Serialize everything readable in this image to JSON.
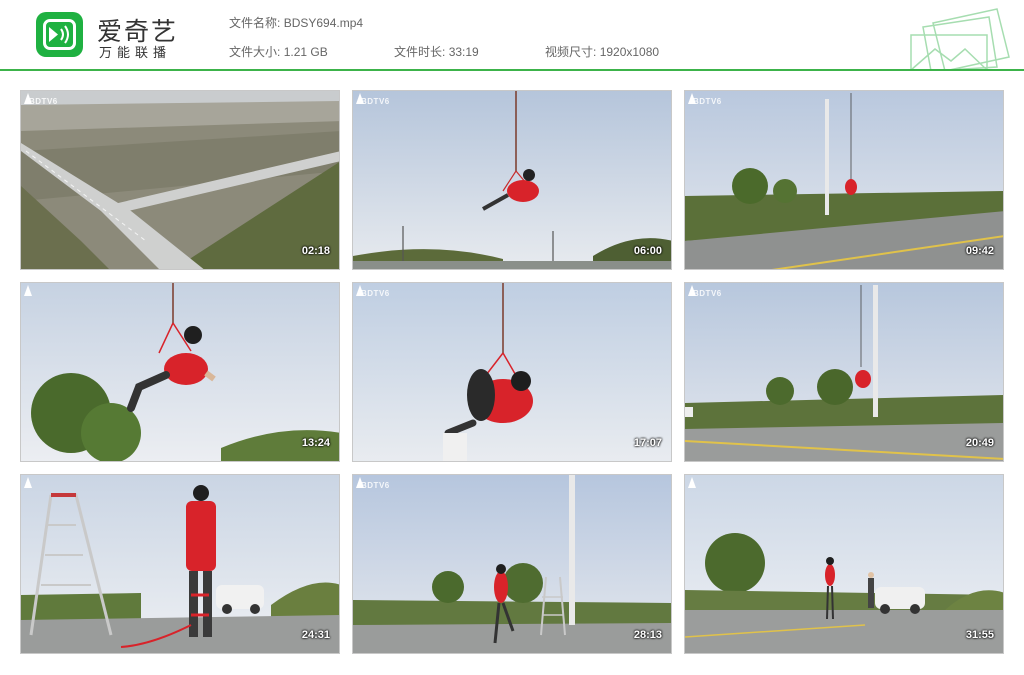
{
  "app": {
    "brand_name": "爱奇艺",
    "brand_sub": "万能联播",
    "brand_color": "#1fb141"
  },
  "file_info": {
    "name_label": "文件名称:",
    "name_value": "BDSY694.mp4",
    "size_label": "文件大小:",
    "size_value": "1.21 GB",
    "duration_label": "文件时长:",
    "duration_value": "33:19",
    "resolution_label": "视频尺寸:",
    "resolution_value": "1920x1080"
  },
  "thumbnails": [
    {
      "timestamp": "02:18",
      "watermark": "BDTV6"
    },
    {
      "timestamp": "06:00",
      "watermark": "BDTV6"
    },
    {
      "timestamp": "09:42",
      "watermark": "BDTV6"
    },
    {
      "timestamp": "13:24",
      "watermark": ""
    },
    {
      "timestamp": "17:07",
      "watermark": "BDTV6"
    },
    {
      "timestamp": "20:49",
      "watermark": "BDTV6"
    },
    {
      "timestamp": "24:31",
      "watermark": ""
    },
    {
      "timestamp": "28:13",
      "watermark": "BDTV6"
    },
    {
      "timestamp": "31:55",
      "watermark": ""
    }
  ],
  "colors": {
    "accent": "#3cb34a",
    "figure": "#d8232a"
  }
}
